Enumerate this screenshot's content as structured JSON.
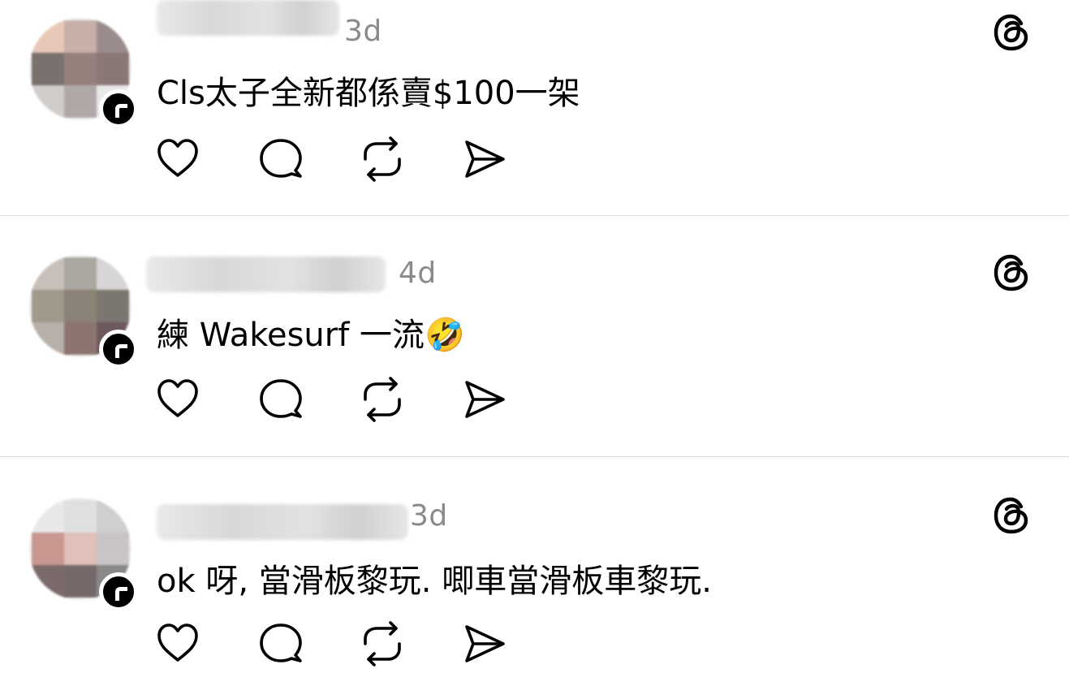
{
  "posts": [
    {
      "time": "3d",
      "text": "Cls太子全新都係賣$100一架",
      "emoji": "",
      "avatar_colors": [
        "#e8c8b8",
        "#c8b0a8",
        "#9a8c8c",
        "#7a706e",
        "#96807c",
        "#8a7876",
        "#d0ccca",
        "#b0a8a6",
        "#e8e8e8"
      ]
    },
    {
      "time": "4d",
      "text": "練 Wakesurf 一流",
      "emoji": "🤣",
      "avatar_colors": [
        "#c8c0b8",
        "#aaa6a0",
        "#d8d6d4",
        "#a09a8c",
        "#8a8276",
        "#7c7670",
        "#b8b0a8",
        "#8c7470",
        "#6e5a5e"
      ]
    },
    {
      "time": "3d",
      "text": "ok 呀, 當滑板黎玩. 唧車當滑板車黎玩.",
      "emoji": "",
      "avatar_colors": [
        "#e8e8e8",
        "#e0e0e0",
        "#cfcfcf",
        "#c89890",
        "#e0c0b8",
        "#c8c4c4",
        "#7a6a6a",
        "#746868",
        "#8a8888"
      ]
    }
  ],
  "actions": [
    "like-icon",
    "comment-icon",
    "repost-icon",
    "share-icon"
  ],
  "colors": {
    "timestamp": "#8a8a8a",
    "divider": "#dcdcdc",
    "icon": "#000000"
  }
}
